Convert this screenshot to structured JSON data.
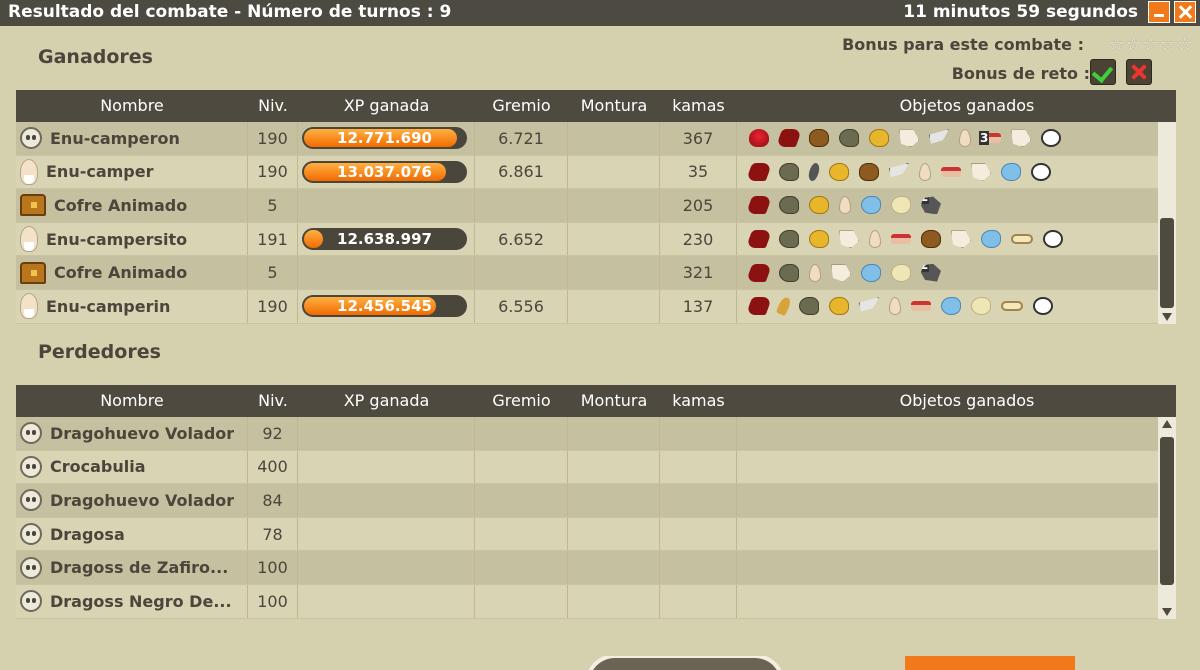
{
  "window": {
    "title": "Resultado del combate - Número de turnos : 9",
    "timer": "11 minutos 59 segundos"
  },
  "bonus": {
    "label": "Bonus para este combate :",
    "stars": "☆☆☆☆☆",
    "reto_label": "Bonus de reto :"
  },
  "columns": {
    "nombre": "Nombre",
    "niv": "Niv.",
    "xp": "XP ganada",
    "gremio": "Gremio",
    "montura": "Montura",
    "kamas": "kamas",
    "objetos": "Objetos ganados"
  },
  "winners": {
    "title": "Ganadores",
    "rows": [
      {
        "avatar": "skull",
        "name": "Enu-camperon",
        "niv": "190",
        "xp": "12.771.690",
        "xp_fill": 0.95,
        "gremio": "6.721",
        "kamas": "367",
        "items": [
          "fire",
          "red",
          "bag",
          "olive",
          "gold",
          "paper",
          "wing",
          "bone",
          "3:sausage",
          "paper",
          "bubble"
        ]
      },
      {
        "avatar": "human",
        "name": "Enu-camper",
        "niv": "190",
        "xp": "13.037.076",
        "xp_fill": 0.88,
        "gremio": "6.861",
        "kamas": "35",
        "items": [
          "red",
          "olive",
          "dark",
          "gold",
          "bag",
          "wing",
          "bone",
          "sausage",
          "paper",
          "blue",
          "bubble"
        ]
      },
      {
        "avatar": "chest",
        "name": "Cofre Animado",
        "niv": "5",
        "xp": "",
        "xp_fill": 0,
        "gremio": "",
        "kamas": "205",
        "items": [
          "red",
          "olive",
          "gold",
          "bone",
          "blue",
          "cream",
          "2:stone"
        ]
      },
      {
        "avatar": "human",
        "name": "Enu-campersito",
        "niv": "191",
        "xp": "12.638.997",
        "xp_fill": 0.12,
        "gremio": "6.652",
        "kamas": "230",
        "items": [
          "red",
          "olive",
          "gold",
          "paper",
          "bone",
          "sausage",
          "bag",
          "paper",
          "blue",
          "glasses",
          "bubble"
        ]
      },
      {
        "avatar": "chest",
        "name": "Cofre Animado",
        "niv": "5",
        "xp": "",
        "xp_fill": 0,
        "gremio": "",
        "kamas": "321",
        "items": [
          "red",
          "olive",
          "bone",
          "paper",
          "blue",
          "cream",
          "2:stone"
        ]
      },
      {
        "avatar": "human",
        "name": "Enu-camperin",
        "niv": "190",
        "xp": "12.456.545",
        "xp_fill": 0.82,
        "gremio": "6.556",
        "kamas": "137",
        "items": [
          "red",
          "horn",
          "olive",
          "gold",
          "wing",
          "bone",
          "sausage",
          "blue",
          "cream",
          "glasses",
          "bubble"
        ]
      }
    ]
  },
  "losers": {
    "title": "Perdedores",
    "rows": [
      {
        "avatar": "skull",
        "name": "Dragohuevo Volador",
        "niv": "92"
      },
      {
        "avatar": "skull",
        "name": "Crocabulia",
        "niv": "400"
      },
      {
        "avatar": "skull",
        "name": "Dragohuevo Volador",
        "niv": "84"
      },
      {
        "avatar": "skull",
        "name": "Dragosa",
        "niv": "78"
      },
      {
        "avatar": "skull",
        "name": "Dragoss de Zafiro...",
        "niv": "100"
      },
      {
        "avatar": "skull",
        "name": "Dragoss Negro De...",
        "niv": "100"
      }
    ]
  },
  "colors": {
    "titlebar": "#4d4a42",
    "background": "#d5d0ae",
    "xp_fill": "#f26a00",
    "accent_orange": "#f07a1a"
  }
}
